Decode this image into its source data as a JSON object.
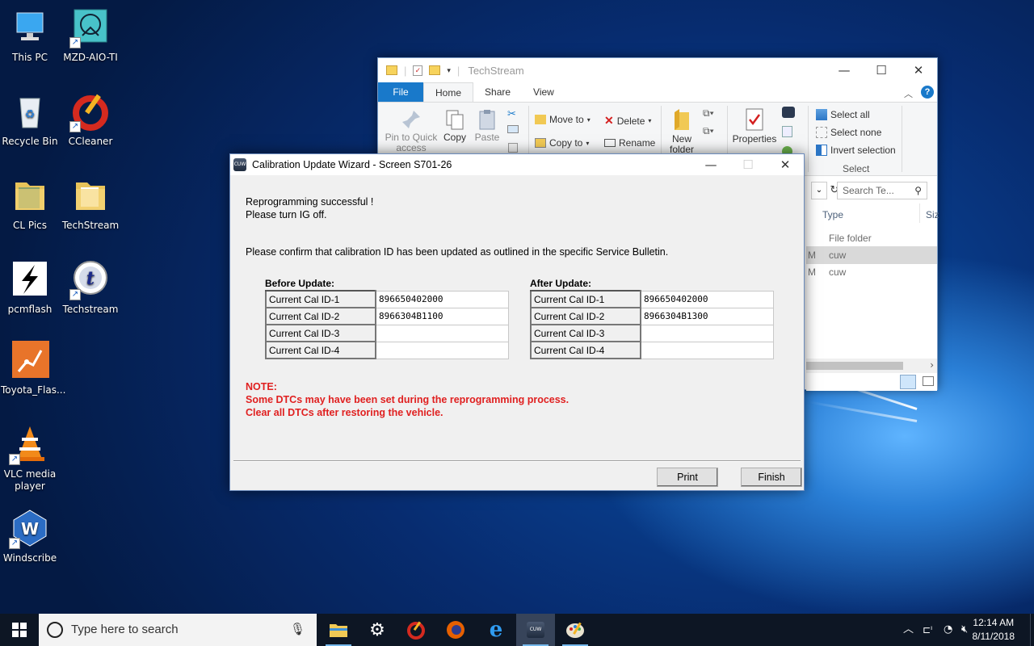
{
  "desktop": {
    "icons": [
      {
        "label": "This PC"
      },
      {
        "label": "MZD-AIO-TI"
      },
      {
        "label": "Recycle Bin"
      },
      {
        "label": "CCleaner"
      },
      {
        "label": "CL Pics"
      },
      {
        "label": "TechStream"
      },
      {
        "label": "pcmflash"
      },
      {
        "label": "Techstream"
      },
      {
        "label": "Toyota_Flas..."
      },
      {
        "label": "VLC media player"
      },
      {
        "label": "Windscribe"
      }
    ]
  },
  "explorer": {
    "title": "TechStream",
    "tabs": [
      "File",
      "Home",
      "Share",
      "View"
    ],
    "ribbon": {
      "pin": "Pin to Quick access",
      "copy": "Copy",
      "paste": "Paste",
      "move_to": "Move to",
      "copy_to": "Copy to",
      "delete": "Delete",
      "rename": "Rename",
      "new_folder": "New folder",
      "properties": "Properties",
      "select_all": "Select all",
      "select_none": "Select none",
      "invert_selection": "Invert selection",
      "select_group": "Select"
    },
    "search_placeholder": "Search Te...",
    "columns": {
      "type": "Type",
      "size": "Siz"
    },
    "rows": [
      {
        "date_fragment": "",
        "type": "File folder"
      },
      {
        "date_fragment": "M",
        "type": "cuw"
      },
      {
        "date_fragment": "M",
        "type": "cuw"
      }
    ]
  },
  "wizard": {
    "title": "Calibration Update Wizard - Screen S701-26",
    "line1": "Reprogramming successful !",
    "line2": "Please turn IG off.",
    "confirm": "Please confirm that calibration ID has been updated as outlined in the specific Service Bulletin.",
    "before_label": "Before Update:",
    "after_label": "After Update:",
    "before": [
      {
        "key": "Current Cal ID-1",
        "value": "896650402000"
      },
      {
        "key": "Current Cal ID-2",
        "value": "8966304B1100"
      },
      {
        "key": "Current Cal ID-3",
        "value": ""
      },
      {
        "key": "Current Cal ID-4",
        "value": ""
      }
    ],
    "after": [
      {
        "key": "Current Cal ID-1",
        "value": "896650402000"
      },
      {
        "key": "Current Cal ID-2",
        "value": "8966304B1300"
      },
      {
        "key": "Current Cal ID-3",
        "value": ""
      },
      {
        "key": "Current Cal ID-4",
        "value": ""
      }
    ],
    "note_title": "NOTE:",
    "note_line1": "Some DTCs may have been set during the reprogramming process.",
    "note_line2": "Clear all DTCs after restoring the vehicle.",
    "print": "Print",
    "finish": "Finish"
  },
  "taskbar": {
    "search_placeholder": "Type here to search",
    "time": "12:14 AM",
    "date": "8/11/2018"
  },
  "colors": {
    "accent": "#1979ca",
    "note_red": "#e02020",
    "taskbar": "#0d1624"
  }
}
